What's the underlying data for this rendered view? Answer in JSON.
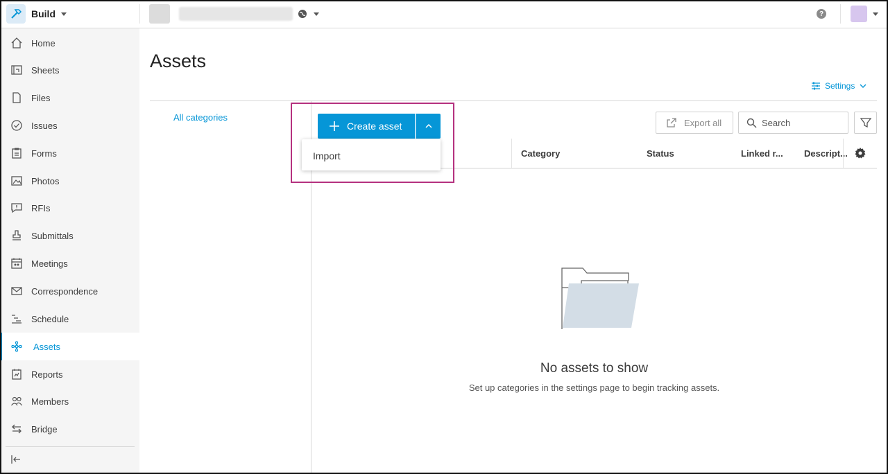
{
  "topbar": {
    "app_name": "Build",
    "help_icon": "help-icon",
    "globe_icon": "globe-icon"
  },
  "sidebar": {
    "items": [
      {
        "label": "Home",
        "icon": "home-icon"
      },
      {
        "label": "Sheets",
        "icon": "sheets-icon"
      },
      {
        "label": "Files",
        "icon": "file-icon"
      },
      {
        "label": "Issues",
        "icon": "check-circle-icon"
      },
      {
        "label": "Forms",
        "icon": "clipboard-icon"
      },
      {
        "label": "Photos",
        "icon": "photo-icon"
      },
      {
        "label": "RFIs",
        "icon": "rfi-icon"
      },
      {
        "label": "Submittals",
        "icon": "stamp-icon"
      },
      {
        "label": "Meetings",
        "icon": "calendar-people-icon"
      },
      {
        "label": "Correspondence",
        "icon": "envelope-icon"
      },
      {
        "label": "Schedule",
        "icon": "schedule-icon"
      },
      {
        "label": "Assets",
        "icon": "asset-icon",
        "active": true
      },
      {
        "label": "Reports",
        "icon": "report-icon"
      },
      {
        "label": "Members",
        "icon": "people-icon"
      },
      {
        "label": "Bridge",
        "icon": "bridge-arrows-icon"
      }
    ]
  },
  "main": {
    "title": "Assets",
    "settings_label": "Settings",
    "all_categories": "All categories",
    "create_asset": "Create asset",
    "dropdown_items": [
      "Import"
    ],
    "export_all": "Export all",
    "search_placeholder": "Search",
    "columns": [
      "Category",
      "Status",
      "Linked r...",
      "Descript..."
    ],
    "empty_title": "No assets to show",
    "empty_subtitle": "Set up categories in the settings page to begin tracking assets."
  },
  "colors": {
    "accent": "#0696d7",
    "highlight_border": "#b5317f"
  }
}
